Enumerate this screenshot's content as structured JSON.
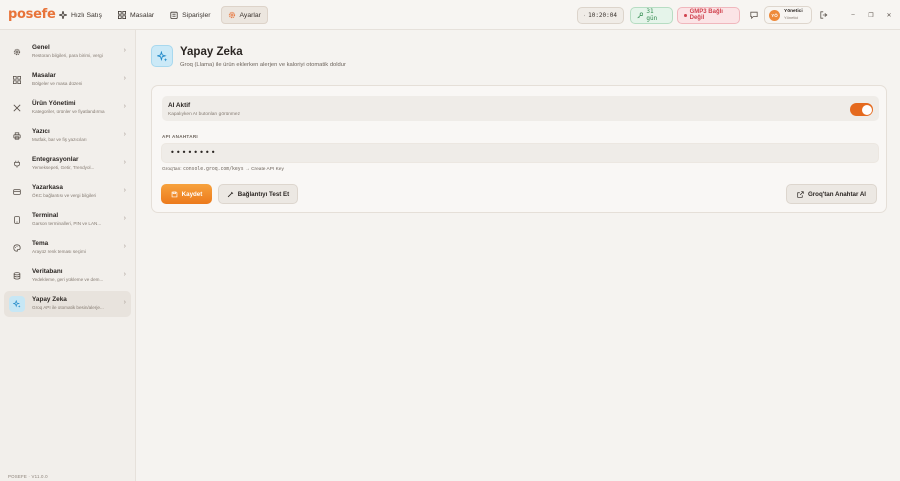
{
  "app": {
    "logo": "posefe",
    "version": "POSEFE · V11.0.0"
  },
  "nav": [
    {
      "label": "Hızlı Satış",
      "icon": "sparkle-icon"
    },
    {
      "label": "Masalar",
      "icon": "grid-icon"
    },
    {
      "label": "Siparişler",
      "icon": "clipboard-icon"
    },
    {
      "label": "Ayarlar",
      "icon": "gear-icon",
      "active": true
    }
  ],
  "status": {
    "clock": "10:20:04",
    "days": "31 gün",
    "gmp": "GMP3 Bağlı Değil"
  },
  "user": {
    "initials": "YÖ",
    "name": "Yönetici",
    "role": "Yönetici"
  },
  "window": {
    "minimize": "–",
    "restore": "❐",
    "close": "✕"
  },
  "sidebar": {
    "items": [
      {
        "title": "Genel",
        "sub": "Restoran bilgileri, para birimi, vergi",
        "icon": "gear-icon"
      },
      {
        "title": "Masalar",
        "sub": "Bölgeler ve masa düzeni",
        "icon": "grid-icon"
      },
      {
        "title": "Ürün Yönetimi",
        "sub": "Kategoriler, ürünler ve fiyatlandırma",
        "icon": "utensils-icon"
      },
      {
        "title": "Yazıcı",
        "sub": "Mutfak, bar ve fiş yazıcıları",
        "icon": "printer-icon"
      },
      {
        "title": "Entegrasyonlar",
        "sub": "Yemeksepeti, Getir, Trendyol...",
        "icon": "plug-icon"
      },
      {
        "title": "Yazarkasa",
        "sub": "ÖKC bağlantısı ve vergi bilgileri",
        "icon": "register-icon"
      },
      {
        "title": "Terminal",
        "sub": "Garson terminalleri, PIN ve LAN...",
        "icon": "tablet-icon"
      },
      {
        "title": "Tema",
        "sub": "Arayüz renk teması seçimi",
        "icon": "palette-icon"
      },
      {
        "title": "Veritabanı",
        "sub": "Yedekleme, geri yükleme ve dem...",
        "icon": "database-icon"
      },
      {
        "title": "Yapay Zeka",
        "sub": "Groq API ile otomatik besin/alerje...",
        "icon": "ai-sparkle-icon",
        "active": true
      }
    ]
  },
  "page": {
    "title": "Yapay Zeka",
    "subtitle": "Groq (Llama) ile ürün eklerken alerjen ve kaloriyi otomatik doldur",
    "ai_toggle": {
      "label": "AI Aktif",
      "description": "Kapalıyken AI butonları görünmez",
      "on": true
    },
    "api_key": {
      "label": "API ANAHTARI",
      "value": "••••••••",
      "hint_prefix": "Groq'tan:",
      "hint_url": "console.groq.com/keys",
      "hint_suffix": "→ Create API Key"
    },
    "buttons": {
      "save": "Kaydet",
      "test": "Bağlantıyı Test Et",
      "get_key": "Groq'tan Anahtar Al"
    }
  }
}
